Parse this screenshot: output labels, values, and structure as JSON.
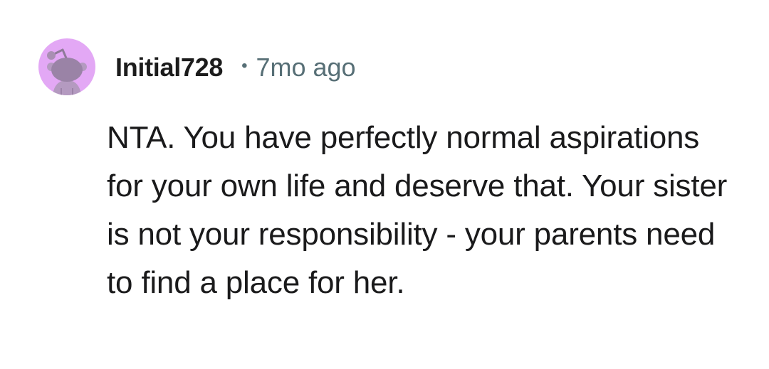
{
  "comment": {
    "author": "Initial728",
    "separator": "•",
    "timestamp": "7mo ago",
    "body": "NTA. You have perfectly normal aspirations for your own life and deserve that. Your sister is not your responsibility - your parents need to find a place for her."
  },
  "avatar": {
    "icon": "snoo-avatar-icon",
    "background_color": "#e3a8f5"
  }
}
